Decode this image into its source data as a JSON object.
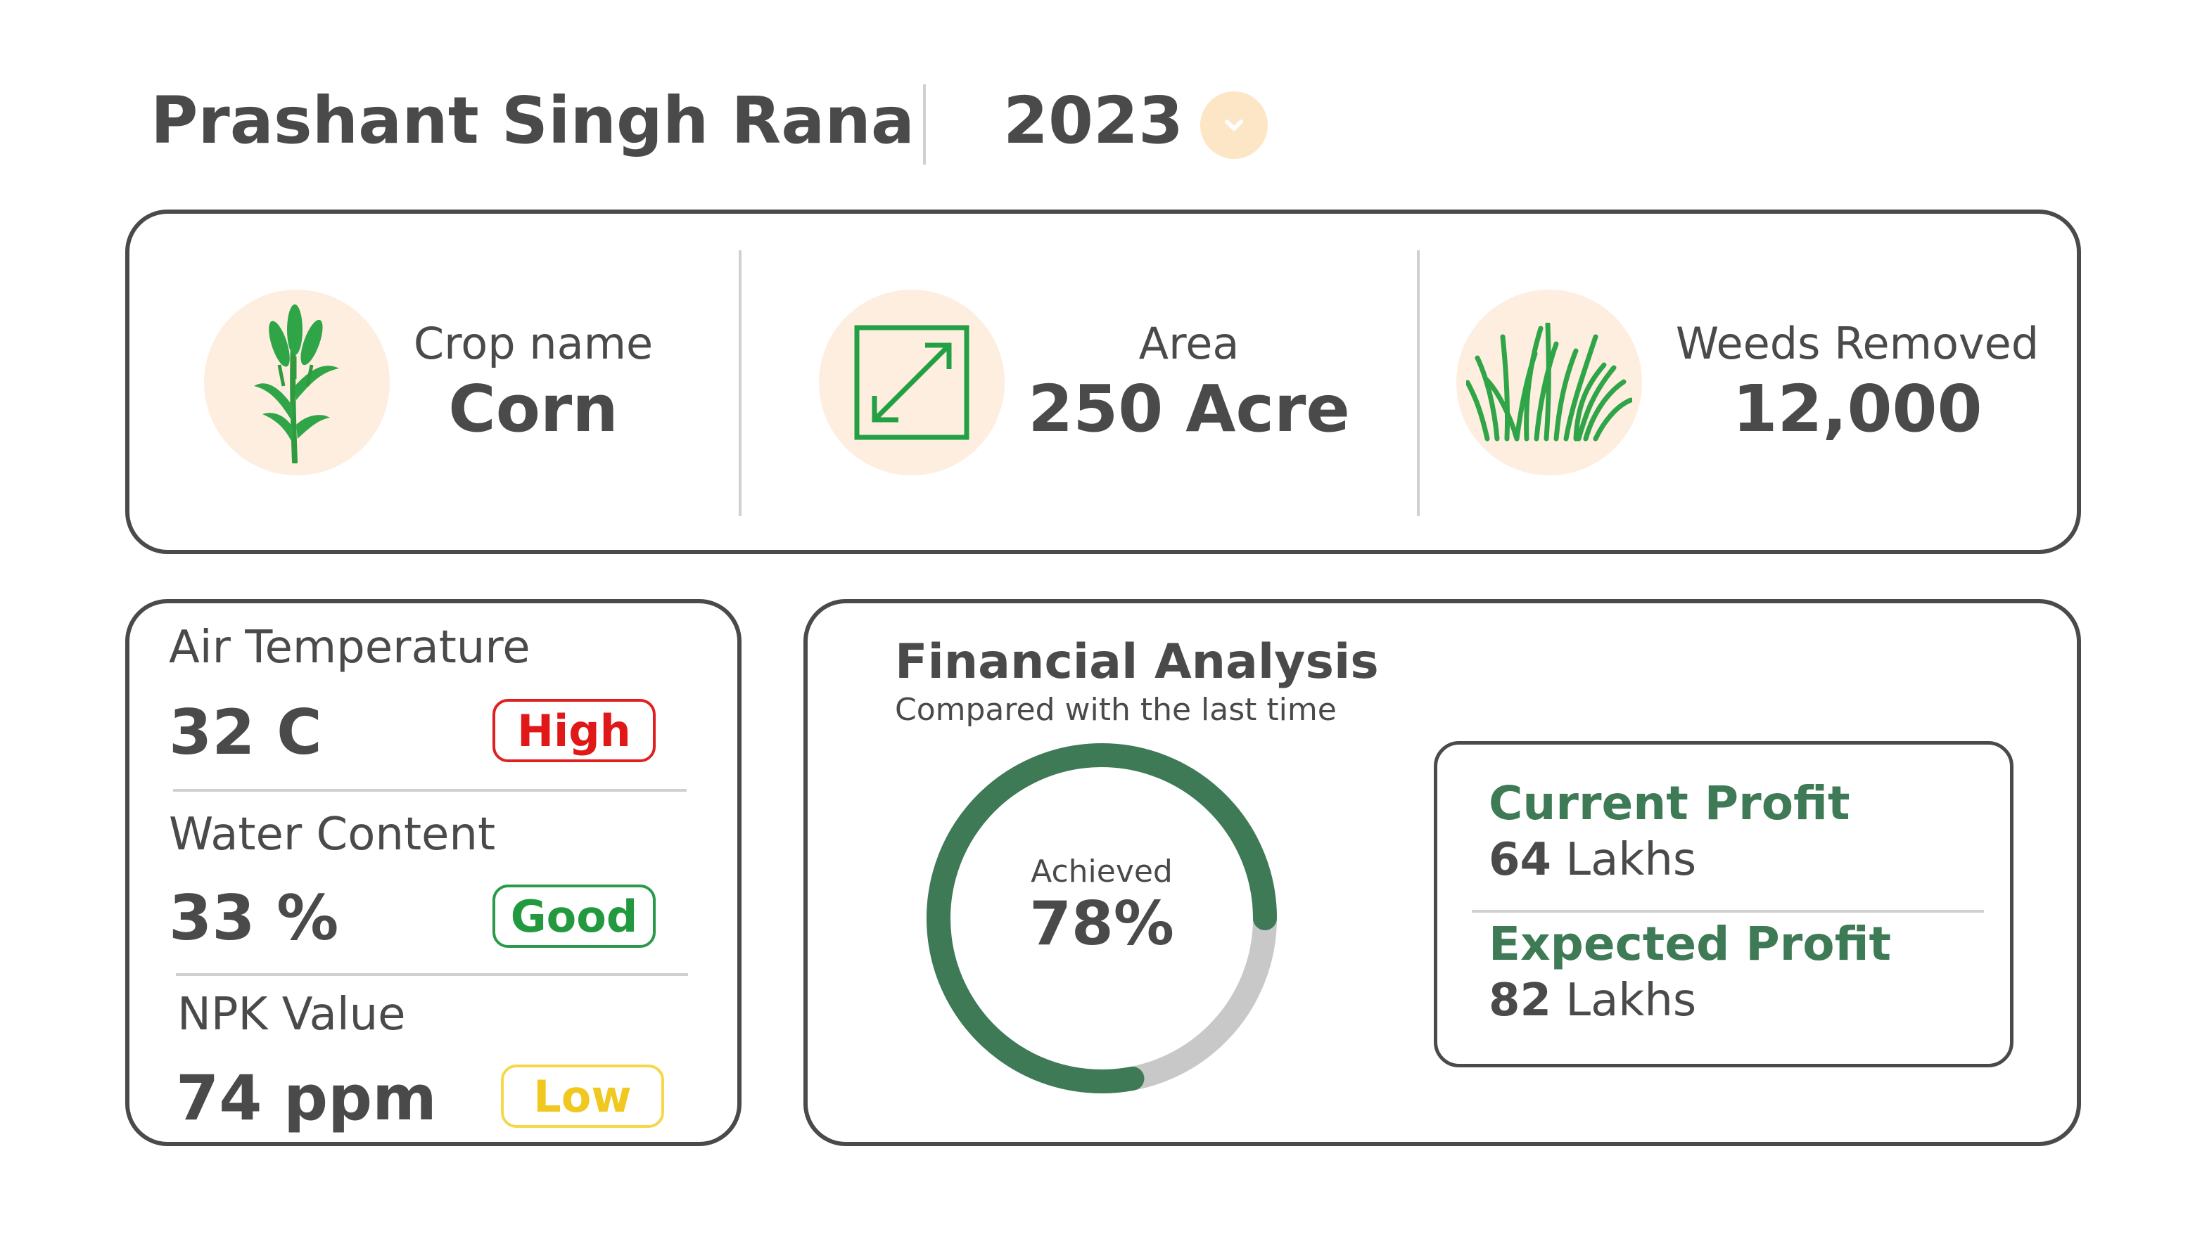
{
  "header": {
    "farmer_name": "Prashant Singh Rana",
    "year": "2023",
    "year_dropdown_icon": "chevron-down-icon"
  },
  "summary": {
    "crop": {
      "label": "Crop name",
      "value": "Corn",
      "icon": "crop-plant-icon"
    },
    "area": {
      "label": "Area",
      "value": "250 Acre",
      "icon": "expand-diagonal-icon"
    },
    "weeds": {
      "label": "Weeds Removed",
      "value": "12,000",
      "icon": "grass-icon"
    }
  },
  "environment": {
    "air": {
      "label": "Air Temperature",
      "value": "32 C",
      "status": "High",
      "status_color": "#e01818"
    },
    "water": {
      "label": "Water Content",
      "value": "33 %",
      "status": "Good",
      "status_color": "#23993f"
    },
    "npk": {
      "label": "NPK Value",
      "value": "74 ppm",
      "status": "Low",
      "status_color": "#f0c820"
    }
  },
  "financial": {
    "title": "Financial Analysis",
    "subtitle": "Compared with the last time",
    "achieved_label": "Achieved",
    "achieved_value": "78%",
    "achieved_fraction": 0.78,
    "current_profit_label": "Current Profit",
    "current_profit_amount": "64",
    "current_profit_unit": "Lakhs",
    "expected_profit_label": "Expected Profit",
    "expected_profit_amount": "82",
    "expected_profit_unit": "Lakhs"
  },
  "colors": {
    "accent_green": "#3d7a55",
    "donut_track": "#c8c8c8",
    "icon_bg": "#fdeee0",
    "text": "#4a4a4a"
  }
}
